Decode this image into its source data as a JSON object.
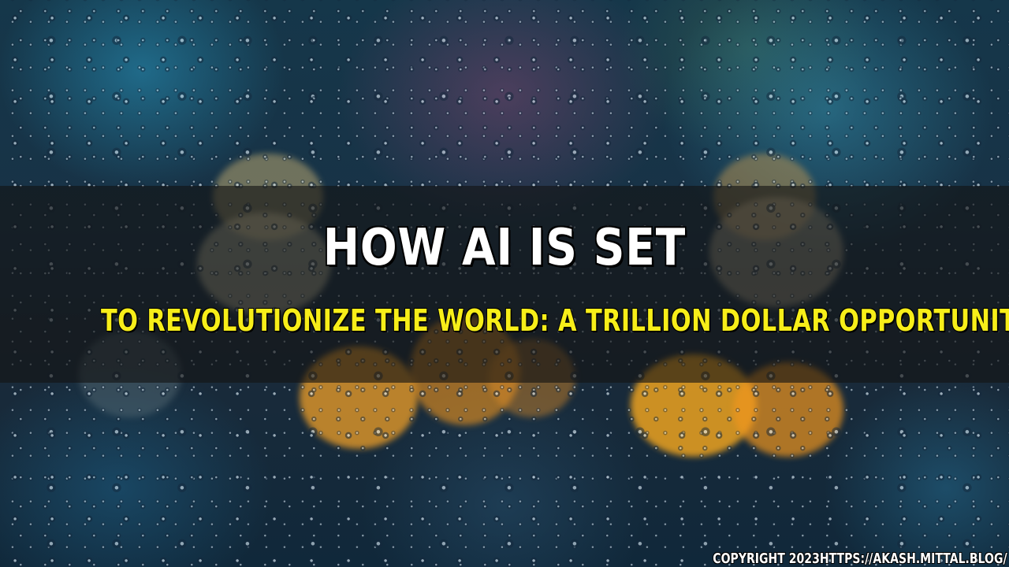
{
  "headline": {
    "line1": "HOW AI IS SET",
    "line2": "TO REVOLUTIONIZE THE WORLD: A TRILLION DOLLAR OPPORTUNITY"
  },
  "footer": {
    "copyright": "COPYRIGHT 2023HTTPS://AKASH.MITTAL.BLOG/"
  },
  "colors": {
    "headline_primary": "#ffffff",
    "headline_secondary": "#f7ee19",
    "band": "#141414"
  }
}
